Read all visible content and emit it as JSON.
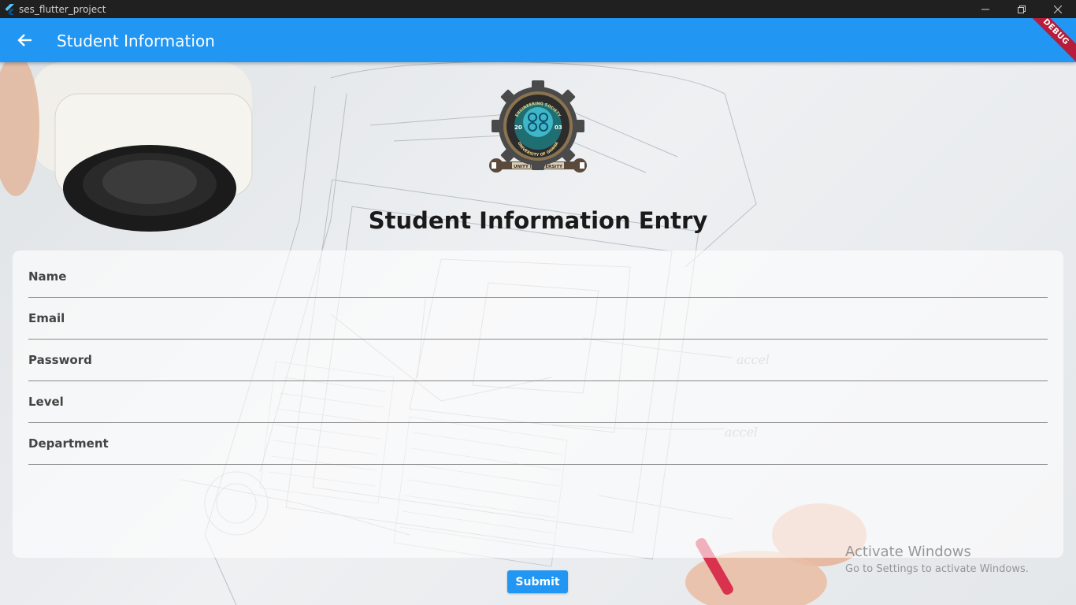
{
  "window": {
    "title": "ses_flutter_project",
    "controls": [
      "minimize",
      "restore",
      "close"
    ]
  },
  "appbar": {
    "title": "Student Information",
    "back_icon": "arrow-back-icon",
    "debug_banner": "DEBUG",
    "color": "#2196f3"
  },
  "logo": {
    "ring_top_text": "ENGINEERING SOCIETY",
    "year_left": "20",
    "year_right": "03",
    "ring_bottom_text": "UNIVERSITY OF GHANA",
    "banner_text": "UNITY IN DIVERSITY"
  },
  "page": {
    "heading": "Student Information Entry"
  },
  "form": {
    "fields": [
      {
        "label": "Name",
        "value": ""
      },
      {
        "label": "Email",
        "value": ""
      },
      {
        "label": "Password",
        "value": ""
      },
      {
        "label": "Level",
        "value": ""
      },
      {
        "label": "Department",
        "value": ""
      }
    ],
    "submit_label": "Submit"
  },
  "watermark": {
    "title": "Activate Windows",
    "subtitle": "Go to Settings to activate Windows."
  }
}
